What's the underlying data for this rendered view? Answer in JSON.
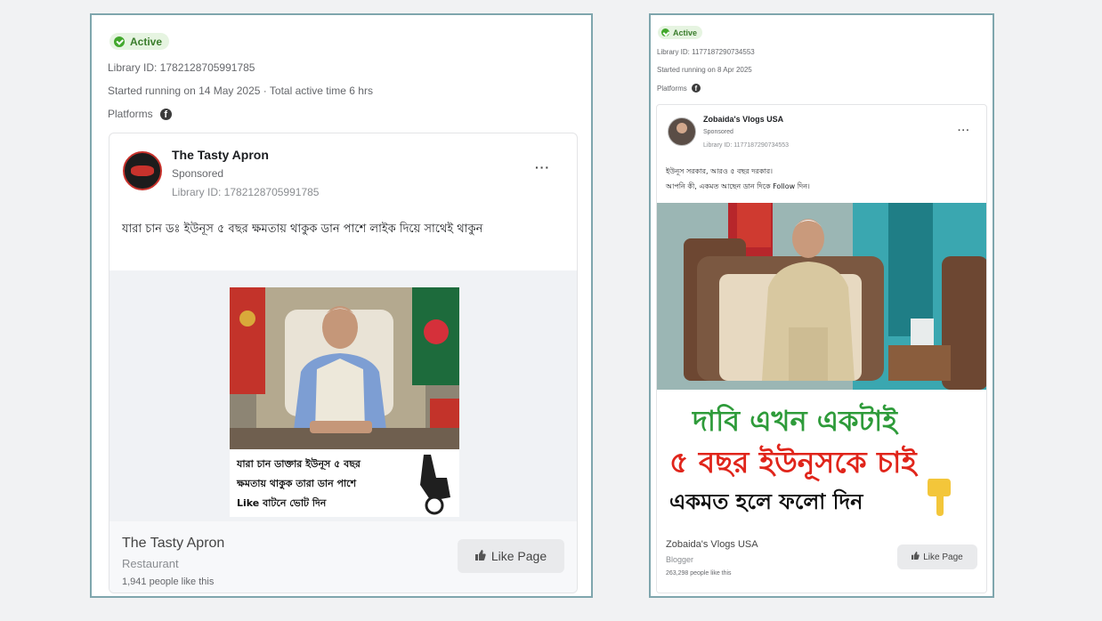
{
  "left_ad": {
    "status": "Active",
    "library_id": "Library ID: 1782128705991785",
    "started": "Started running on 14 May 2025 · Total active time 6 hrs",
    "platforms_label": "Platforms",
    "page_name": "The Tasty Apron",
    "sponsored": "Sponsored",
    "post_library_id": "Library ID: 1782128705991785",
    "post_text": "যারা চান ডঃ ইউনূস ৫ বছর ক্ষমতায় থাকুক ডান পাশে লাইক দিয়ে সাথেই থাকুন",
    "image_caption_line1": "যারা চান ডাক্তার ইউনূস ৫ বছর",
    "image_caption_line2": "ক্ষমতায় থাকুক তারা ডান পাশে",
    "image_caption_line3": "Like বাটনে ভোট দিন",
    "footer_name": "The Tasty Apron",
    "footer_category": "Restaurant",
    "footer_likes": "1,941 people like this",
    "like_button": "Like Page"
  },
  "right_ad": {
    "status": "Active",
    "library_id": "Library ID: 1177187290734553",
    "started": "Started running on 8 Apr 2025",
    "platforms_label": "Platforms",
    "page_name": "Zobaida's Vlogs USA",
    "sponsored": "Sponsored",
    "post_library_id": "Library ID: 1177187290734553",
    "post_text_line1": "ইউনূস সরকার, আরও ৫ বছর দরকার।",
    "post_text_line2": "আপনি কী, একমত আছেন ডান দিকে Follow দিন।",
    "banner_line1": "দাবি এখন একটাই",
    "banner_line2": "৫ বছর ইউনূসকে চাই",
    "banner_line3": "একমত হলে ফলো দিন",
    "footer_name": "Zobaida's Vlogs USA",
    "footer_category": "Blogger",
    "footer_likes": "263,298 people like this",
    "like_button": "Like Page"
  },
  "colors": {
    "card_border": "#7fa6ad",
    "active_green": "#42a82c",
    "banner_green": "#2e9b3a",
    "banner_red": "#e0251b"
  }
}
